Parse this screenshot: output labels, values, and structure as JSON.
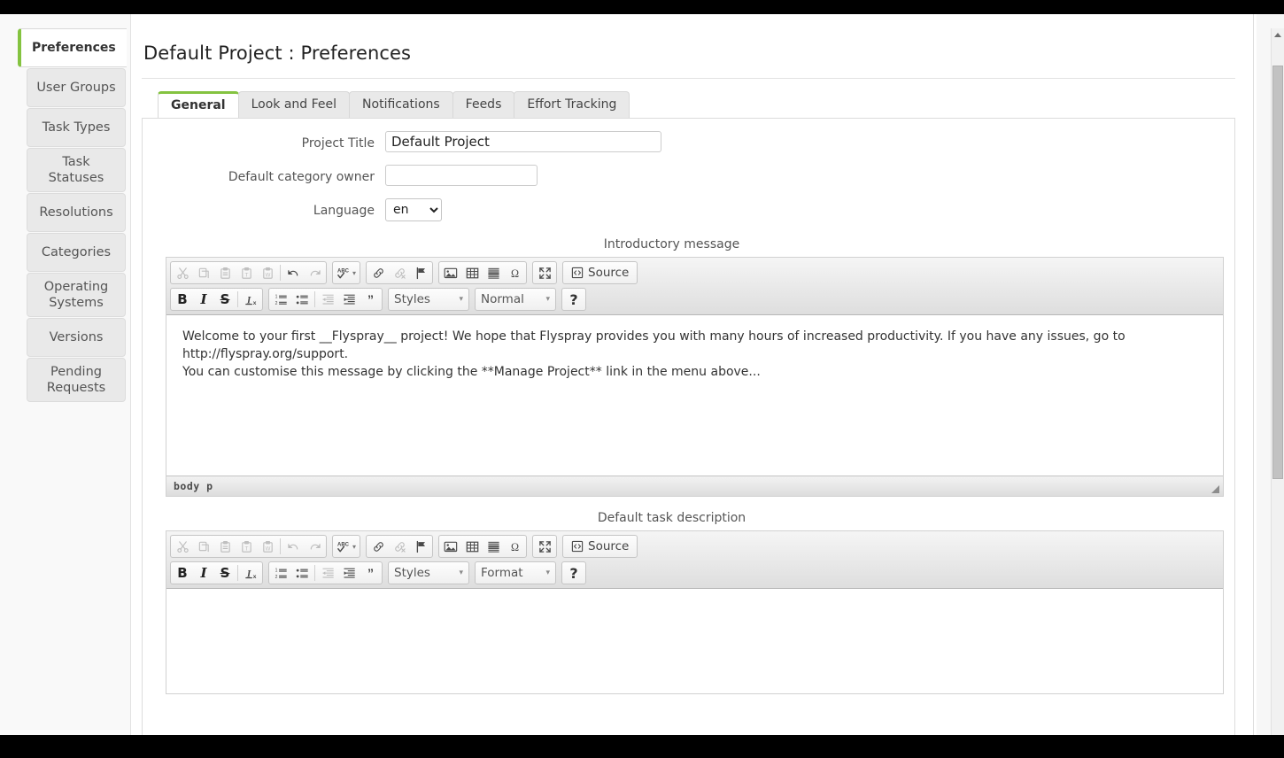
{
  "sidebar": {
    "items": [
      {
        "label": "Preferences",
        "active": true
      },
      {
        "label": "User Groups",
        "active": false
      },
      {
        "label": "Task Types",
        "active": false
      },
      {
        "label": "Task Statuses",
        "active": false
      },
      {
        "label": "Resolutions",
        "active": false
      },
      {
        "label": "Categories",
        "active": false
      },
      {
        "label": "Operating Systems",
        "active": false
      },
      {
        "label": "Versions",
        "active": false
      },
      {
        "label": "Pending Requests",
        "active": false
      }
    ]
  },
  "header": {
    "title": "Default Project : Preferences"
  },
  "tabs": [
    {
      "label": "General",
      "active": true
    },
    {
      "label": "Look and Feel",
      "active": false
    },
    {
      "label": "Notifications",
      "active": false
    },
    {
      "label": "Feeds",
      "active": false
    },
    {
      "label": "Effort Tracking",
      "active": false
    }
  ],
  "form": {
    "project_title": {
      "label": "Project Title",
      "value": "Default Project",
      "placeholder": ""
    },
    "default_category_owner": {
      "label": "Default category owner",
      "value": "",
      "placeholder": ""
    },
    "language": {
      "label": "Language",
      "value": "en",
      "options": [
        "en"
      ]
    }
  },
  "editors": [
    {
      "label": "Introductory message",
      "body_paragraphs": [
        "Welcome to your first __Flyspray__ project! We hope that Flyspray provides you with many hours of increased productivity. If you have any issues, go to http://flyspray.org/support.",
        "You can customise this message by clicking the **Manage Project** link in the menu above..."
      ],
      "format_label": "Normal",
      "styles_label": "Styles",
      "source_label": "Source",
      "help_label": "?",
      "elements_path": "body  p",
      "show_footer": true
    },
    {
      "label": "Default task description",
      "body_paragraphs": [],
      "format_label": "Format",
      "styles_label": "Styles",
      "source_label": "Source",
      "help_label": "?",
      "elements_path": "",
      "show_footer": false
    }
  ],
  "toolbar_icons": {
    "cut": "cut-icon",
    "copy": "copy-icon",
    "paste": "paste-icon",
    "paste_text": "paste-as-text-icon",
    "paste_word": "paste-from-word-icon",
    "undo": "undo-icon",
    "redo": "redo-icon",
    "spellcheck": "spellcheck-icon",
    "link": "link-icon",
    "unlink": "unlink-icon",
    "anchor": "anchor-flag-icon",
    "image": "image-icon",
    "table": "table-icon",
    "hrule": "horizontal-rule-icon",
    "special_char": "omega-special-character-icon",
    "maximize": "maximize-icon",
    "source": "source-code-icon",
    "bold": "bold-icon",
    "italic": "italic-icon",
    "strike": "strikethrough-icon",
    "remove_format": "remove-format-icon",
    "numbered_list": "numbered-list-icon",
    "bulleted_list": "bulleted-list-icon",
    "outdent": "outdent-icon",
    "indent": "indent-icon",
    "blockquote": "blockquote-icon"
  },
  "toolbar_glyphs": {
    "bold": "B",
    "italic": "I",
    "strike": "S",
    "omega": "Ω",
    "quote": "”"
  },
  "scrollbar": {
    "up_arrow": "scroll-up-arrow",
    "down_arrow": "scroll-down-arrow"
  },
  "colors": {
    "accent_green": "#84c340",
    "panel_border": "#dcdcdc",
    "sidebar_item_bg": "#e9e9e9",
    "text": "#333333"
  }
}
